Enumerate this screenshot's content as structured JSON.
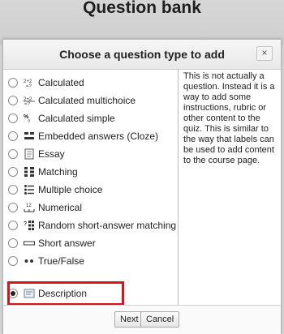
{
  "page": {
    "heading": "Question bank"
  },
  "dialog": {
    "title": "Choose a question type to add",
    "close_label": "×",
    "options": [
      {
        "label": "Calculated",
        "icon": "calculated-icon"
      },
      {
        "label": "Calculated multichoice",
        "icon": "calculated-multichoice-icon"
      },
      {
        "label": "Calculated simple",
        "icon": "calculated-simple-icon"
      },
      {
        "label": "Embedded answers (Cloze)",
        "icon": "cloze-icon"
      },
      {
        "label": "Essay",
        "icon": "essay-icon"
      },
      {
        "label": "Matching",
        "icon": "matching-icon"
      },
      {
        "label": "Multiple choice",
        "icon": "multiple-choice-icon"
      },
      {
        "label": "Numerical",
        "icon": "numerical-icon"
      },
      {
        "label": "Random short-answer matching",
        "icon": "random-matching-icon"
      },
      {
        "label": "Short answer",
        "icon": "short-answer-icon"
      },
      {
        "label": "True/False",
        "icon": "true-false-icon"
      },
      {
        "label": "Description",
        "icon": "description-icon",
        "selected": true
      }
    ],
    "description": "This is not actually a question. Instead it is a way to add some instructions, rubric or other content to the quiz. This is similar to the way that labels can be used to add content to the course page.",
    "buttons": {
      "next": "Next",
      "cancel": "Cancel"
    },
    "highlight_color": "#d5141b"
  }
}
